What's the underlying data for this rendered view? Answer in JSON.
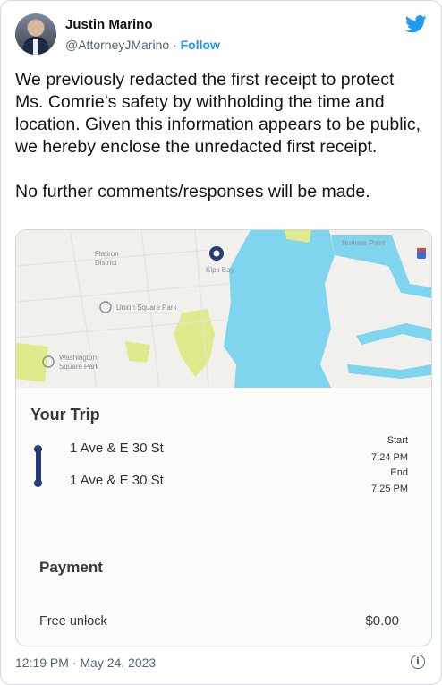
{
  "author": {
    "name": "Justin Marino",
    "handle": "@AttorneyJMarino",
    "separator": "·",
    "follow_label": "Follow"
  },
  "tweet": {
    "paragraph1": "We previously redacted the first receipt to protect Ms. Comrie’s safety by withholding the time and location. Given this information appears to be public, we hereby enclose the unredacted first receipt.",
    "paragraph2": "No further comments/responses will be made."
  },
  "receipt": {
    "map_labels": {
      "flatiron": "Flatiron\nDistrict",
      "kips_bay": "Kips Bay",
      "union_square": "Union Square Park",
      "washington_square": "Washington\nSquare Park",
      "hunters_point": "Hunters Point"
    },
    "trip_title": "Your Trip",
    "start_stop": "1 Ave & E 30 St",
    "end_stop": "1 Ave & E 30 St",
    "start_label": "Start",
    "start_time": "7:24 PM",
    "end_label": "End",
    "end_time": "7:25 PM",
    "payment_title": "Payment",
    "payment_item": "Free unlock",
    "payment_amount": "$0.00"
  },
  "footer": {
    "timestamp": "12:19 PM · May 24, 2023",
    "info_icon": "i"
  },
  "colors": {
    "accent": "#1d9bf0",
    "water": "#7fd4ee",
    "park": "#e0ea8a",
    "route": "#253a78"
  },
  "icons": [
    "twitter-bird-icon",
    "info-icon",
    "location-pin-icon",
    "park-icon"
  ]
}
